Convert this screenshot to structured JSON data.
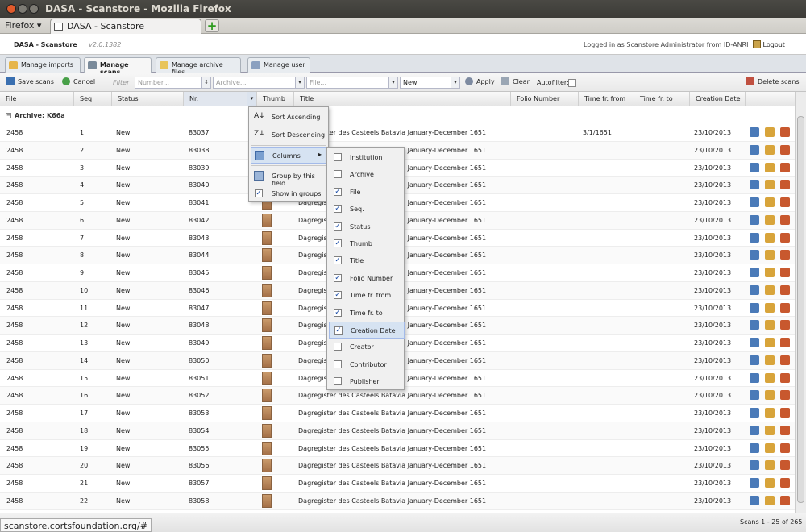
{
  "window": {
    "title": "DASA - Scanstore - Mozilla Firefox"
  },
  "browser": {
    "menu": "Firefox ▾",
    "tab_title": "DASA - Scanstore",
    "new_tab": "+",
    "status_url": "scanstore.cortsfoundation.org/#"
  },
  "app": {
    "name": "DASA - Scanstore",
    "version": "v2.0.1382",
    "login_text": "Logged in as",
    "user": "Scanstore Administrator",
    "from": "from",
    "org": "ID-ANRI",
    "logout": "Logout"
  },
  "module_tabs": [
    "Manage imports",
    "Manage scans",
    "Manage archive files",
    "Manage user"
  ],
  "toolbar": {
    "save": "Save scans",
    "cancel": "Cancel",
    "filter_label": "Filter",
    "number_ph": "Number...",
    "archive_ph": "Archive...",
    "file_ph": "File...",
    "status_value": "New",
    "apply": "Apply",
    "clear": "Clear",
    "autofilter": "Autofilter:",
    "delete": "Delete scans"
  },
  "columns": [
    "File",
    "Seq.",
    "Status",
    "Nr.",
    "Thumb",
    "Title",
    "Folio Number",
    "Time fr. from",
    "Time fr. to",
    "Creation Date"
  ],
  "group_label": "Archive: K66a",
  "rows": [
    {
      "file": "2458",
      "seq": "1",
      "status": "New",
      "nr": "83037",
      "title": "Dagregister des Casteels Batavia January-December 1651",
      "tfrom": "3/1/1651",
      "date": "23/10/2013"
    },
    {
      "file": "2458",
      "seq": "2",
      "status": "New",
      "nr": "83038",
      "title": "Dagregister des Casteels Batavia January-December 1651",
      "tfrom": "",
      "date": "23/10/2013"
    },
    {
      "file": "2458",
      "seq": "3",
      "status": "New",
      "nr": "83039",
      "title": "Dagregister des Casteels Batavia January-December 1651",
      "tfrom": "",
      "date": "23/10/2013"
    },
    {
      "file": "2458",
      "seq": "4",
      "status": "New",
      "nr": "83040",
      "title": "Dagregister des Casteels Batavia January-December 1651",
      "tfrom": "",
      "date": "23/10/2013"
    },
    {
      "file": "2458",
      "seq": "5",
      "status": "New",
      "nr": "83041",
      "title": "Dagregister des Casteels Batavia January-December 1651",
      "tfrom": "",
      "date": "23/10/2013"
    },
    {
      "file": "2458",
      "seq": "6",
      "status": "New",
      "nr": "83042",
      "title": "Dagregister des Casteels Batavia January-December 1651",
      "tfrom": "",
      "date": "23/10/2013"
    },
    {
      "file": "2458",
      "seq": "7",
      "status": "New",
      "nr": "83043",
      "title": "Dagregister des Casteels Batavia January-December 1651",
      "tfrom": "",
      "date": "23/10/2013"
    },
    {
      "file": "2458",
      "seq": "8",
      "status": "New",
      "nr": "83044",
      "title": "Dagregister des Casteels Batavia January-December 1651",
      "tfrom": "",
      "date": "23/10/2013"
    },
    {
      "file": "2458",
      "seq": "9",
      "status": "New",
      "nr": "83045",
      "title": "Dagregister des Casteels Batavia January-December 1651",
      "tfrom": "",
      "date": "23/10/2013"
    },
    {
      "file": "2458",
      "seq": "10",
      "status": "New",
      "nr": "83046",
      "title": "Dagregister des Casteels Batavia January-December 1651",
      "tfrom": "",
      "date": "23/10/2013"
    },
    {
      "file": "2458",
      "seq": "11",
      "status": "New",
      "nr": "83047",
      "title": "Dagregister des Casteels Batavia January-December 1651",
      "tfrom": "",
      "date": "23/10/2013"
    },
    {
      "file": "2458",
      "seq": "12",
      "status": "New",
      "nr": "83048",
      "title": "Dagregister des Casteels Batavia January-December 1651",
      "tfrom": "",
      "date": "23/10/2013"
    },
    {
      "file": "2458",
      "seq": "13",
      "status": "New",
      "nr": "83049",
      "title": "Dagregister des Casteels Batavia January-December 1651",
      "tfrom": "",
      "date": "23/10/2013"
    },
    {
      "file": "2458",
      "seq": "14",
      "status": "New",
      "nr": "83050",
      "title": "Dagregister des Casteels Batavia January-December 1651",
      "tfrom": "",
      "date": "23/10/2013"
    },
    {
      "file": "2458",
      "seq": "15",
      "status": "New",
      "nr": "83051",
      "title": "Dagregister des Casteels Batavia January-December 1651",
      "tfrom": "",
      "date": "23/10/2013"
    },
    {
      "file": "2458",
      "seq": "16",
      "status": "New",
      "nr": "83052",
      "title": "Dagregister des Casteels Batavia January-December 1651",
      "tfrom": "",
      "date": "23/10/2013"
    },
    {
      "file": "2458",
      "seq": "17",
      "status": "New",
      "nr": "83053",
      "title": "Dagregister des Casteels Batavia January-December 1651",
      "tfrom": "",
      "date": "23/10/2013"
    },
    {
      "file": "2458",
      "seq": "18",
      "status": "New",
      "nr": "83054",
      "title": "Dagregister des Casteels Batavia January-December 1651",
      "tfrom": "",
      "date": "23/10/2013"
    },
    {
      "file": "2458",
      "seq": "19",
      "status": "New",
      "nr": "83055",
      "title": "Dagregister des Casteels Batavia January-December 1651",
      "tfrom": "",
      "date": "23/10/2013"
    },
    {
      "file": "2458",
      "seq": "20",
      "status": "New",
      "nr": "83056",
      "title": "Dagregister des Casteels Batavia January-December 1651",
      "tfrom": "",
      "date": "23/10/2013"
    },
    {
      "file": "2458",
      "seq": "21",
      "status": "New",
      "nr": "83057",
      "title": "Dagregister des Casteels Batavia January-December 1651",
      "tfrom": "",
      "date": "23/10/2013"
    },
    {
      "file": "2458",
      "seq": "22",
      "status": "New",
      "nr": "83058",
      "title": "Dagregister des Casteels Batavia January-December 1651",
      "tfrom": "",
      "date": "23/10/2013"
    }
  ],
  "column_menu": {
    "sort_asc": "Sort Ascending",
    "sort_desc": "Sort Descending",
    "columns": "Columns",
    "group": "Group by this field",
    "show_groups": "Show in groups",
    "show_groups_checked": true
  },
  "column_list": [
    {
      "label": "Institution",
      "checked": false
    },
    {
      "label": "Archive",
      "checked": false
    },
    {
      "label": "File",
      "checked": true
    },
    {
      "label": "Seq.",
      "checked": true
    },
    {
      "label": "Status",
      "checked": true
    },
    {
      "label": "Thumb",
      "checked": true
    },
    {
      "label": "Title",
      "checked": true
    },
    {
      "label": "Folio Number",
      "checked": true
    },
    {
      "label": "Time fr. from",
      "checked": true
    },
    {
      "label": "Time fr. to",
      "checked": true
    },
    {
      "label": "Creation Date",
      "checked": true
    },
    {
      "label": "Creator",
      "checked": false
    },
    {
      "label": "Contributor",
      "checked": false
    },
    {
      "label": "Publisher",
      "checked": false
    }
  ],
  "paging": {
    "summary": "Scans 1 - 25 of 265"
  },
  "colors": {
    "accent": "#99bbe8",
    "menu_highlight": "#d6e3f2",
    "thumb": "#b07e52"
  }
}
